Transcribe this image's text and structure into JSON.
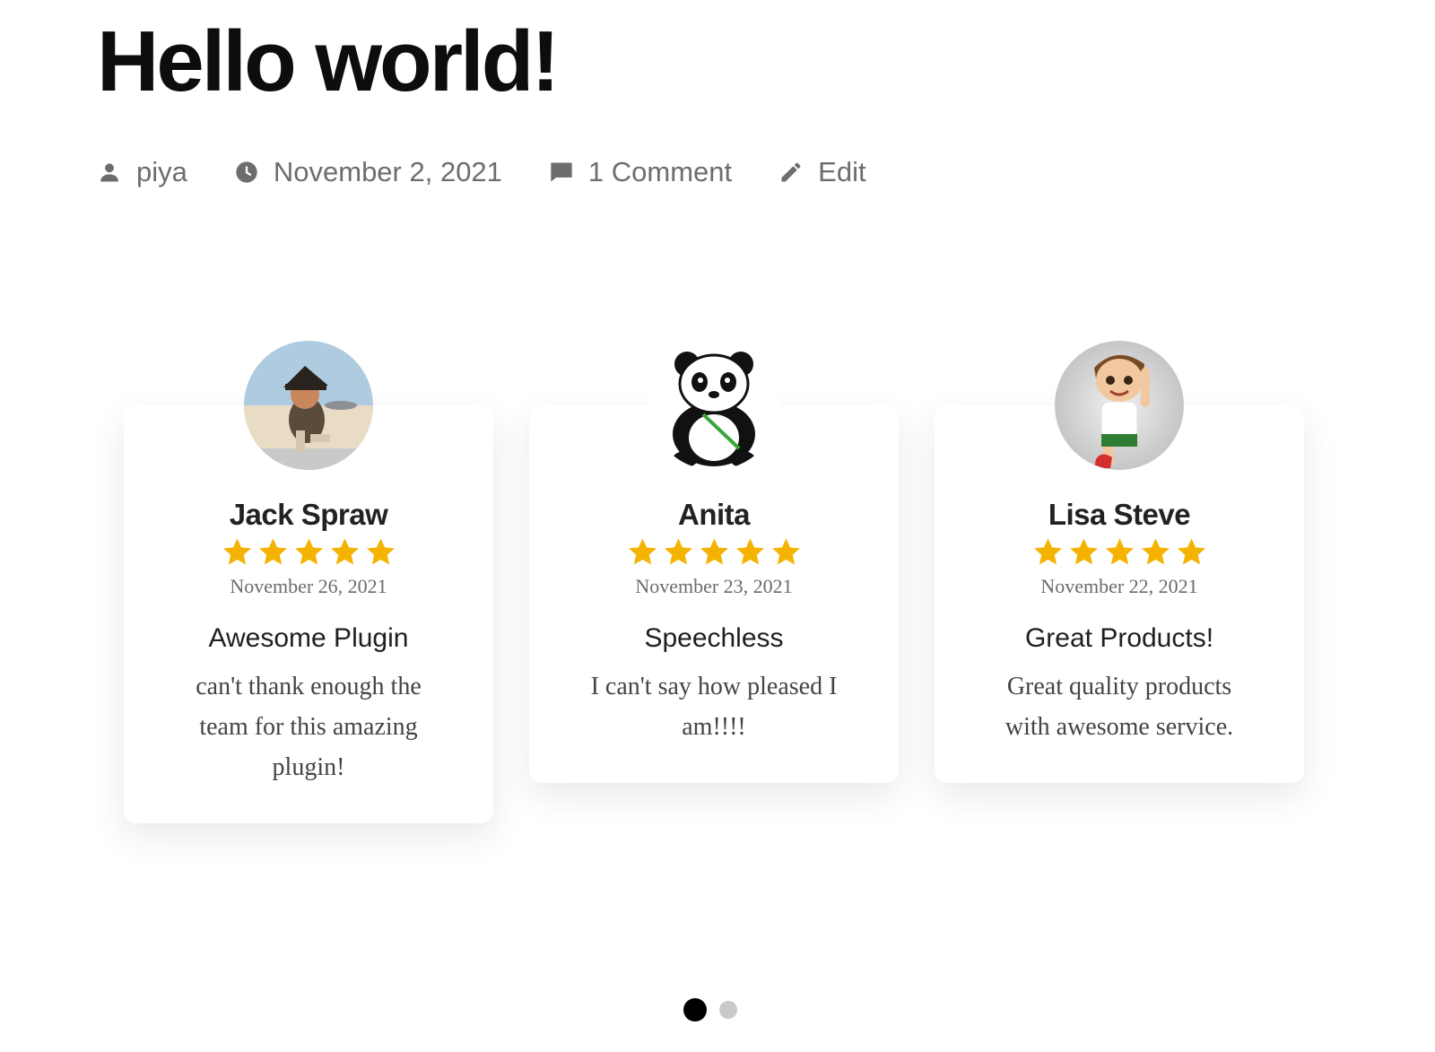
{
  "post": {
    "title": "Hello world!",
    "meta": {
      "author": "piya",
      "date": "November 2, 2021",
      "comments": "1 Comment",
      "edit": "Edit"
    }
  },
  "testimonials": [
    {
      "name": "Jack Spraw",
      "rating": 5,
      "date": "November 26, 2021",
      "title": "Awesome Plugin",
      "text": "can't thank enough the team for this amazing plugin!",
      "avatar_icon": "pirate-avatar"
    },
    {
      "name": "Anita",
      "rating": 5,
      "date": "November 23, 2021",
      "title": "Speechless",
      "text": "I can't say how pleased I am!!!!",
      "avatar_icon": "panda-avatar"
    },
    {
      "name": "Lisa Steve",
      "rating": 5,
      "date": "November 22, 2021",
      "title": "Great Products!",
      "text": "Great quality products with awesome service.",
      "avatar_icon": "cartoon-boy-avatar"
    }
  ],
  "pagination": {
    "pages": 2,
    "active": 1
  },
  "colors": {
    "star": "#f5b301",
    "meta_text": "#6d6d6d",
    "dot_active": "#000000",
    "dot_inactive": "#c9c9c9"
  }
}
